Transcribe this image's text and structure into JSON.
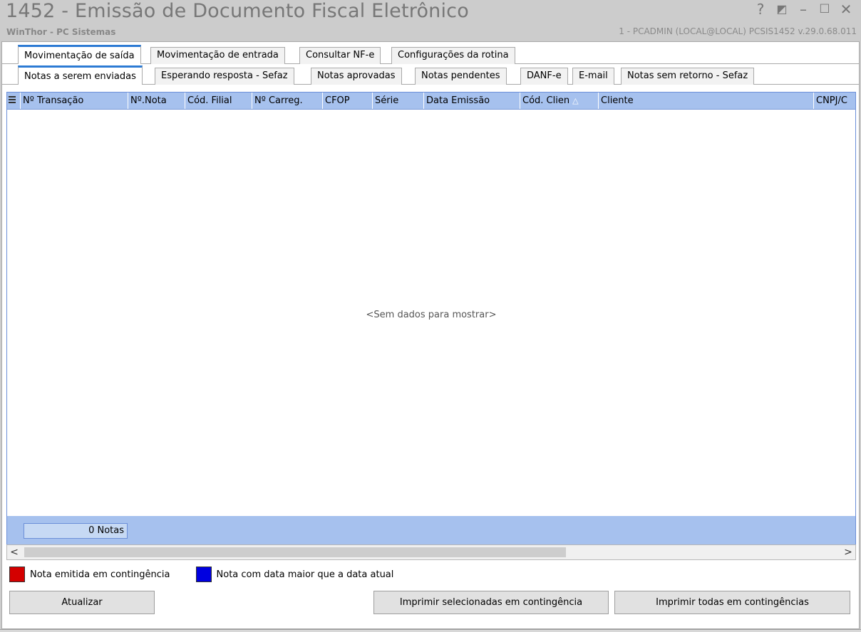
{
  "window": {
    "title": "1452 - Emissão de Documento Fiscal Eletrônico",
    "subtitle": "WinThor - PC Sistemas",
    "user_info": "1 - PCADMIN (LOCAL@LOCAL)  PCSIS1452  v.29.0.68.011",
    "controls": {
      "help": "?",
      "restore": "◩",
      "minimize": "–",
      "maximize": "☐",
      "close": "✕"
    }
  },
  "main_tabs": [
    {
      "label": "Movimentação de saída",
      "active": true
    },
    {
      "label": "Movimentação de entrada",
      "active": false
    },
    {
      "label": "Consultar NF-e",
      "active": false
    },
    {
      "label": "Configurações da rotina",
      "active": false
    }
  ],
  "sub_tabs": [
    {
      "label": "Notas a serem enviadas",
      "active": true
    },
    {
      "label": "Esperando resposta - Sefaz",
      "active": false
    },
    {
      "label": "Notas aprovadas",
      "active": false
    },
    {
      "label": "Notas pendentes",
      "active": false
    },
    {
      "label": "DANF-e",
      "active": false
    },
    {
      "label": "E-mail",
      "active": false
    },
    {
      "label": "Notas sem retorno - Sefaz",
      "active": false
    }
  ],
  "grid": {
    "columns": [
      "Nº Transação",
      "Nº.Nota",
      "Cód. Filial",
      "Nº Carreg.",
      "CFOP",
      "Série",
      "Data Emissão",
      "Cód. Clien",
      "Cliente",
      "CNPJ/C"
    ],
    "sorted_column": "Cód. Clien",
    "empty_message": "<Sem dados para mostrar>",
    "footer_count": "0 Notas"
  },
  "scrollbar": {
    "left_arrow": "<",
    "right_arrow": ">"
  },
  "legend": [
    {
      "label": "Nota emitida em contingência",
      "color": "#d40000"
    },
    {
      "label": "Nota com data maior que a data atual",
      "color": "#0000e0"
    }
  ],
  "buttons": {
    "refresh": "Atualizar",
    "print_selected": "Imprimir selecionadas em contingência",
    "print_all": "Imprimir todas em contingências"
  },
  "colors": {
    "accent": "#2d7bd4",
    "grid_header": "#a6c1ee"
  }
}
